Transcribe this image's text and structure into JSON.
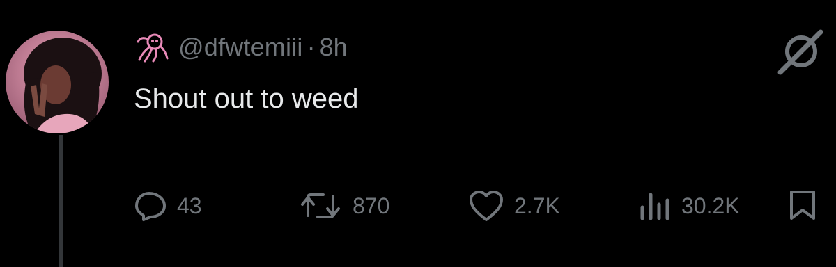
{
  "post": {
    "handle": "@dfwtemiii",
    "separator": "·",
    "time": "8h",
    "text": "Shout out to weed"
  },
  "actions": {
    "replies": "43",
    "reposts": "870",
    "likes": "2.7K",
    "views": "30.2K"
  },
  "icons": {
    "badge": "pink-squid-icon",
    "grok": "grok-icon",
    "reply": "reply-icon",
    "repost": "repost-icon",
    "like": "heart-icon",
    "views": "views-icon",
    "bookmark": "bookmark-icon"
  },
  "colors": {
    "background": "#000000",
    "text": "#e7e9ea",
    "muted": "#71767b",
    "badge": "#e88ab8"
  }
}
